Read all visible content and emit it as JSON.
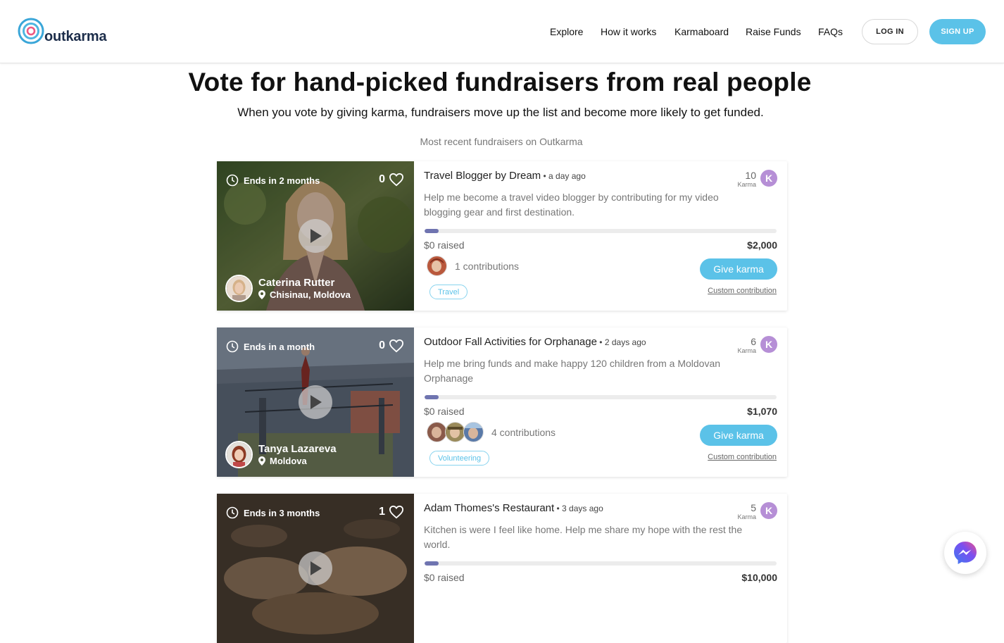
{
  "header": {
    "logo_text": "outkarma",
    "nav": [
      "Explore",
      "How it works",
      "Karmaboard",
      "Raise Funds",
      "FAQs"
    ],
    "login_label": "LOG IN",
    "signup_label": "SIGN UP"
  },
  "hero": {
    "title": "Vote for hand-picked fundraisers from real people",
    "subtitle": "When you vote by giving karma, fundraisers move up the list and become more likely to get funded.",
    "recent_label": "Most recent fundraisers on Outkarma"
  },
  "cards": [
    {
      "ends": "Ends in 2 months",
      "likes": "0",
      "owner_name": "Caterina Rutter",
      "owner_location": "Chisinau, Moldova",
      "title": "Travel Blogger by Dream",
      "ago": " • a day ago",
      "karma": "10",
      "karma_label": "Karma",
      "karma_badge": "K",
      "description": "Help me become a travel video blogger by contributing for my video blogging gear and first destination.",
      "progress": 0.04,
      "raised": "$0 raised",
      "goal": "$2,000",
      "contributions": "1 contributions",
      "give_label": "Give karma",
      "tag": "Travel",
      "custom_label": "Custom contribution"
    },
    {
      "ends": "Ends in a month",
      "likes": "0",
      "owner_name": "Tanya Lazareva",
      "owner_location": "Moldova",
      "title": "Outdoor Fall Activities for Orphanage",
      "ago": " • 2 days ago",
      "karma": "6",
      "karma_label": "Karma",
      "karma_badge": "K",
      "description": "Help me bring funds and make happy 120 children from a Moldovan Orphanage",
      "progress": 0.04,
      "raised": "$0 raised",
      "goal": "$1,070",
      "contributions": "4 contributions",
      "give_label": "Give karma",
      "tag": "Volunteering",
      "custom_label": "Custom contribution"
    },
    {
      "ends": "Ends in 3 months",
      "likes": "1",
      "title": "Adam Thomes's Restaurant",
      "ago": " • 3 days ago",
      "karma": "5",
      "karma_label": "Karma",
      "karma_badge": "K",
      "description": "Kitchen is were I feel like home. Help me share my hope with the rest the world.",
      "progress": 0.04,
      "raised": "$0 raised",
      "goal": "$10,000"
    }
  ],
  "colors": {
    "accent": "#5bc2e8",
    "karma_badge": "#b68fd6",
    "progress": "#6f74b0"
  }
}
